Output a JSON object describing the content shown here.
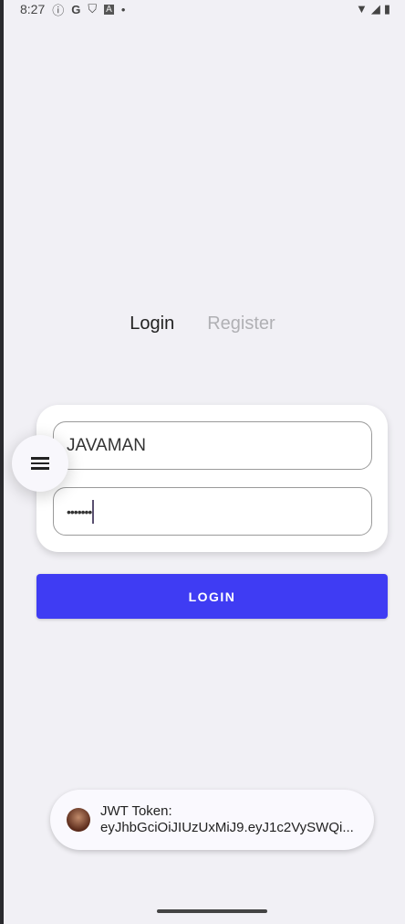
{
  "status_bar": {
    "time": "8:27",
    "icons": [
      "info-icon",
      "google-icon",
      "shield-icon",
      "a-icon",
      "dot-icon"
    ],
    "right_icons": [
      "wifi-icon",
      "signal-icon",
      "battery-icon"
    ]
  },
  "tabs": [
    {
      "label": "Login",
      "active": true
    },
    {
      "label": "Register",
      "active": false
    }
  ],
  "form": {
    "username": "JAVAMAN",
    "password_masked": "•••••••"
  },
  "login_button": "LOGIN",
  "toast": {
    "title": "JWT Token:",
    "token": "eyJhbGciOiJIUzUxMiJ9.eyJ1c2VySWQi..."
  },
  "colors": {
    "accent": "#3f3cf3",
    "background": "#f1f0f5"
  }
}
